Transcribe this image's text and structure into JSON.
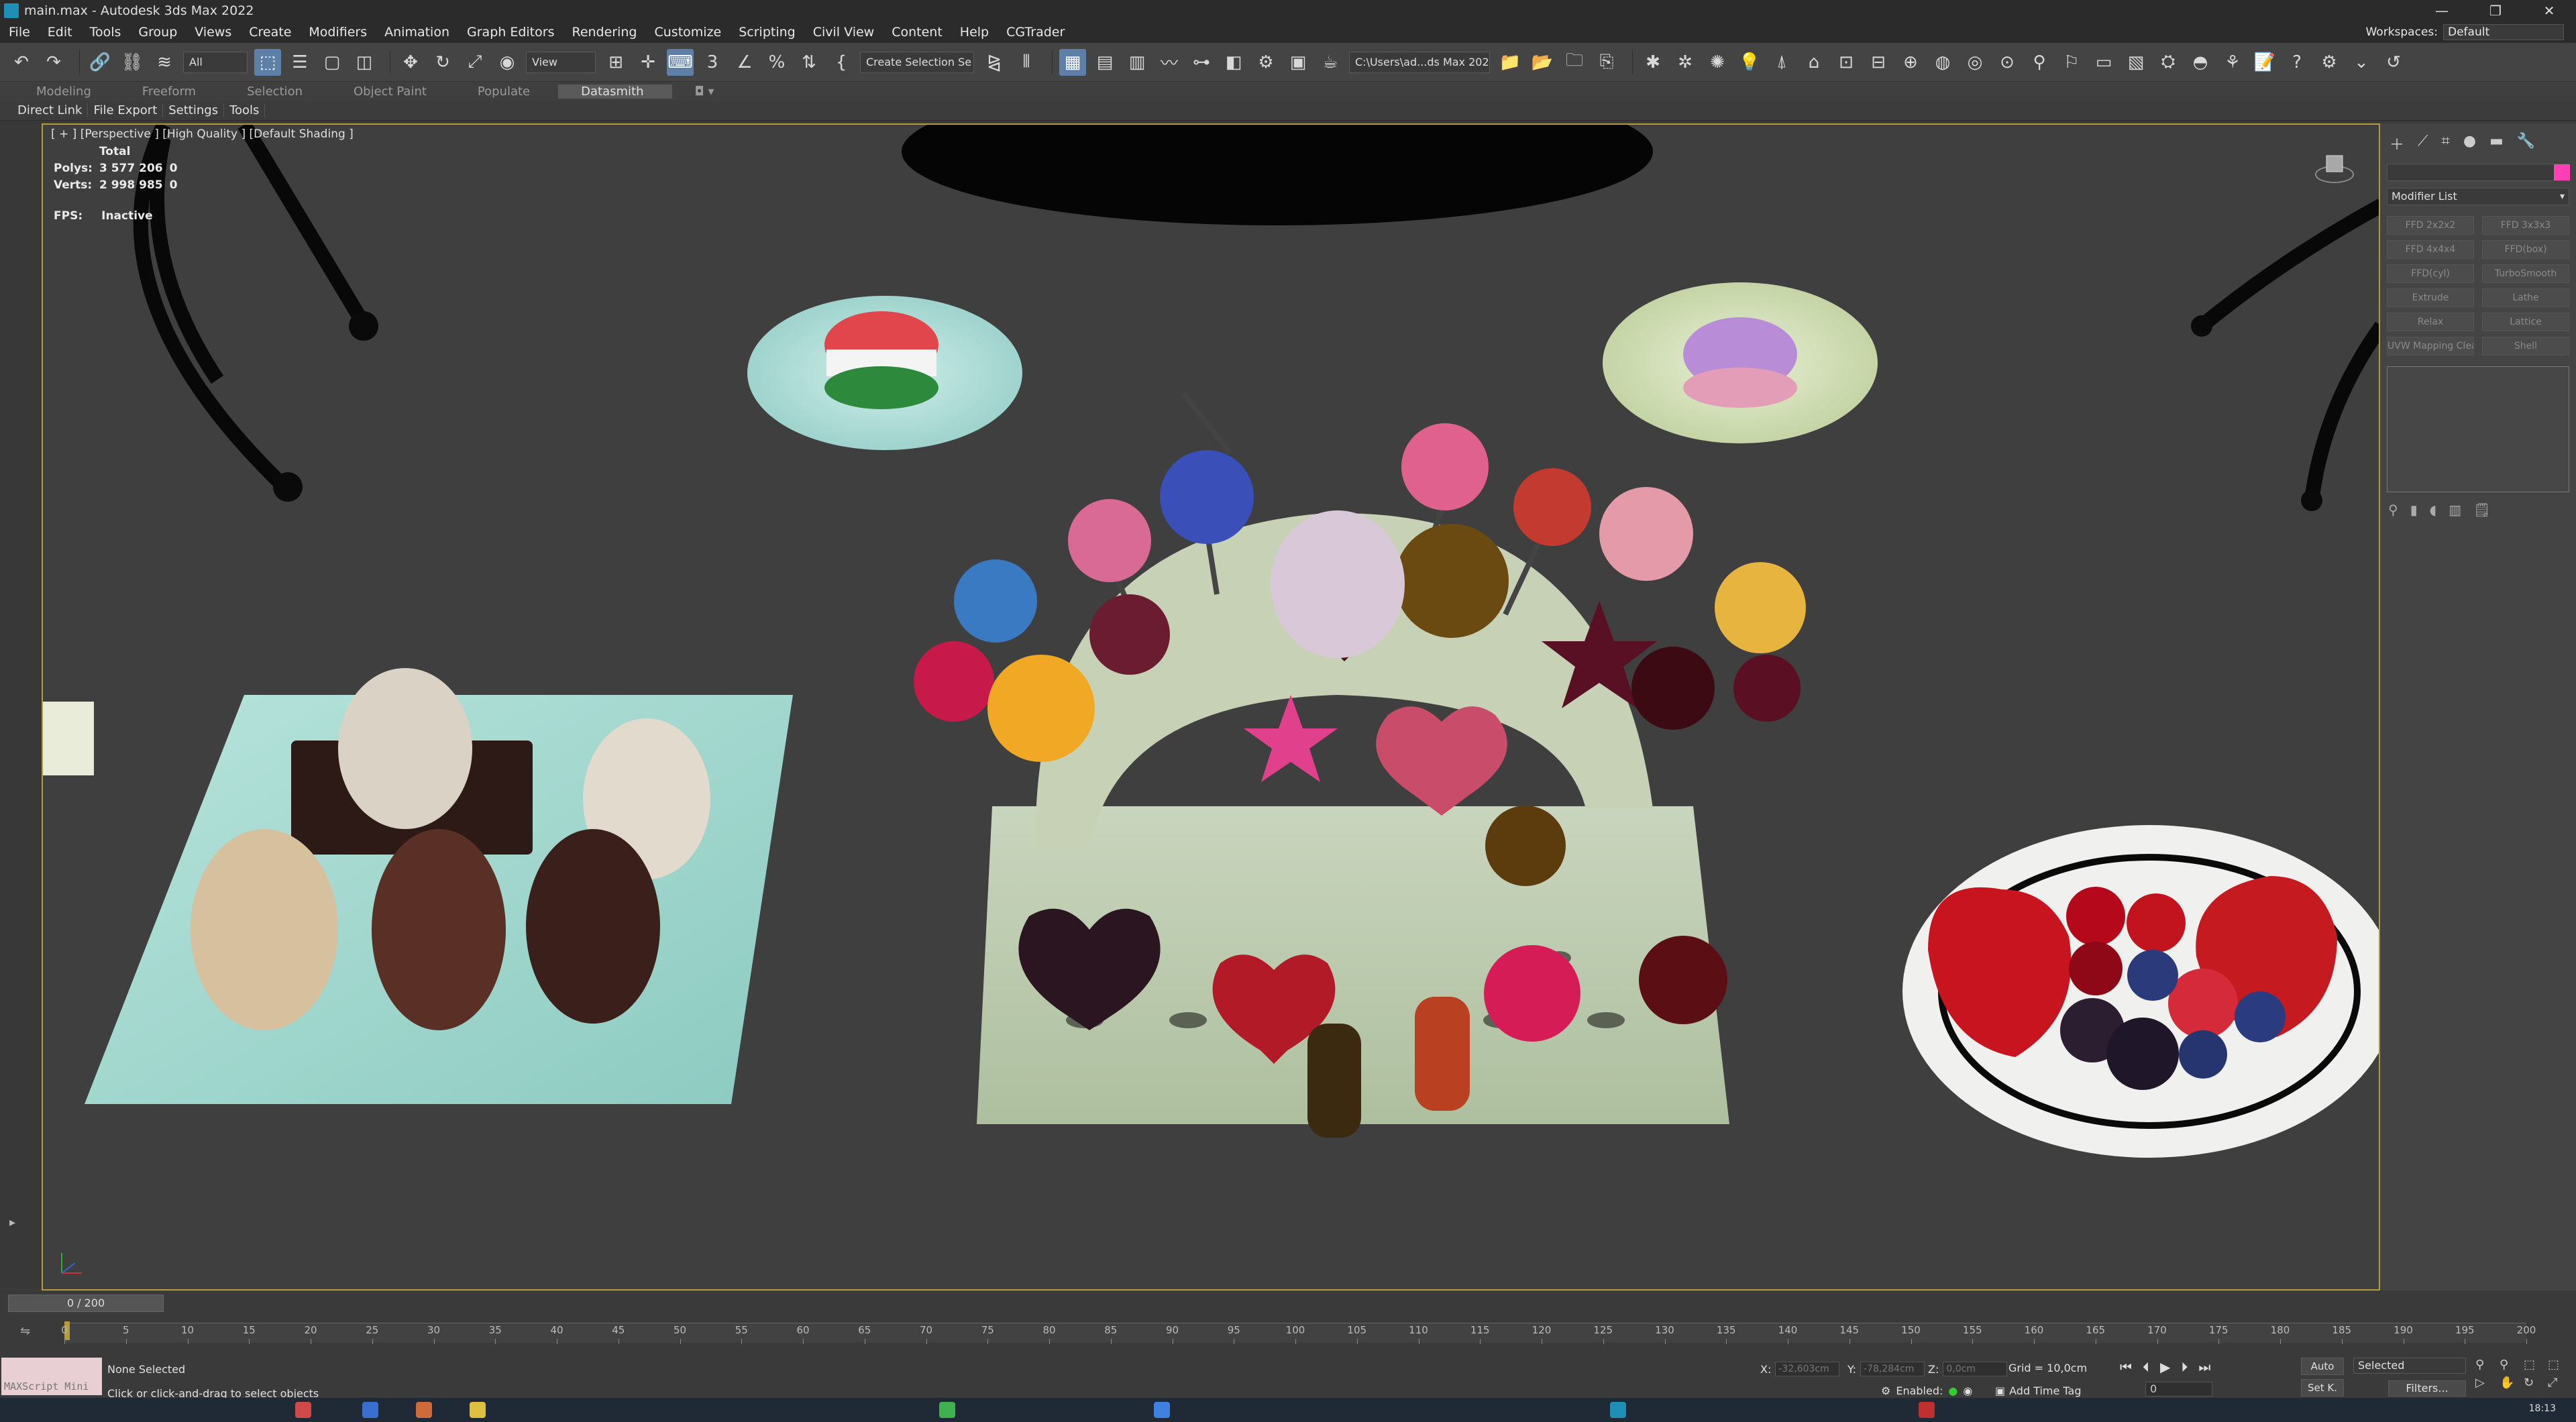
{
  "window": {
    "title": "main.max - Autodesk 3ds Max 2022",
    "controls": [
      "—",
      "❐",
      "✕"
    ]
  },
  "menu": {
    "items": [
      "File",
      "Edit",
      "Tools",
      "Group",
      "Views",
      "Create",
      "Modifiers",
      "Animation",
      "Graph Editors",
      "Rendering",
      "Customize",
      "Scripting",
      "Civil View",
      "Content",
      "Help",
      "CGTrader"
    ],
    "workspaces_label": "Workspaces:",
    "workspaces_value": "Default"
  },
  "toolbar": {
    "filter_value": "All",
    "refcoord_value": "View",
    "selection_set_placeholder": "Create Selection Se",
    "project_path": "C:\\Users\\ad...ds Max 2022",
    "icons": [
      "undo-icon",
      "redo-icon",
      "link-icon",
      "unlink-icon",
      "bind-spacewarp-icon",
      "select-object-icon",
      "select-by-name-icon",
      "rect-region-icon",
      "window-crossing-icon",
      "move-icon",
      "rotate-icon",
      "scale-icon",
      "place-icon"
    ]
  },
  "ribbon": {
    "tabs": [
      "Modeling",
      "Freeform",
      "Selection",
      "Object Paint",
      "Populate",
      "Datasmith"
    ],
    "active_tab": "Datasmith",
    "subtabs": [
      "Direct Link",
      "File Export",
      "Settings",
      "Tools"
    ]
  },
  "viewport": {
    "label": "[ + ] [Perspective ] [High Quality ] [Default Shading ]",
    "stats": {
      "header": "Total",
      "polys_label": "Polys:",
      "polys_total": "3 577 206",
      "polys_sel": "0",
      "verts_label": "Verts:",
      "verts_total": "2 998 985",
      "verts_sel": "0"
    },
    "fps_label": "FPS:",
    "fps_value": "Inactive",
    "border_color": "#b59b3c"
  },
  "command_panel": {
    "modifier_list": "Modifier List",
    "swatch_color": "#ff3fb4",
    "modifiers": [
      "FFD 2x2x2",
      "FFD 3x3x3",
      "FFD 4x4x4",
      "FFD(box)",
      "FFD(cyl)",
      "TurboSmooth",
      "Extrude",
      "Lathe",
      "Relax",
      "Lattice",
      "UVW Mapping Clea",
      "Shell"
    ]
  },
  "timeline": {
    "frame_counter": "0 / 200",
    "ticks": [
      "0",
      "5",
      "10",
      "15",
      "20",
      "25",
      "30",
      "35",
      "40",
      "45",
      "50",
      "55",
      "60",
      "65",
      "70",
      "75",
      "80",
      "85",
      "90",
      "95",
      "100",
      "105",
      "110",
      "115",
      "120",
      "125",
      "130",
      "135",
      "140",
      "145",
      "150",
      "155",
      "160",
      "165",
      "170",
      "175",
      "180",
      "185",
      "190",
      "195",
      "200"
    ]
  },
  "status": {
    "maxscript_label": "MAXScript Mini",
    "selection": "None Selected",
    "prompt": "Click or click-and-drag to select objects",
    "x_label": "X:",
    "x_value": "-32,603cm",
    "y_label": "Y:",
    "y_value": "-78,284cm",
    "z_label": "Z:",
    "z_value": "0,0cm",
    "grid": "Grid = 10,0cm",
    "enabled_label": "Enabled:",
    "add_time_tag": "Add Time Tag",
    "auto_key": "Auto",
    "set_key": "Set K.",
    "selected_dd": "Selected",
    "filters": "Filters...",
    "current_frame": "0"
  },
  "taskbar": {
    "clock": "18:13"
  }
}
